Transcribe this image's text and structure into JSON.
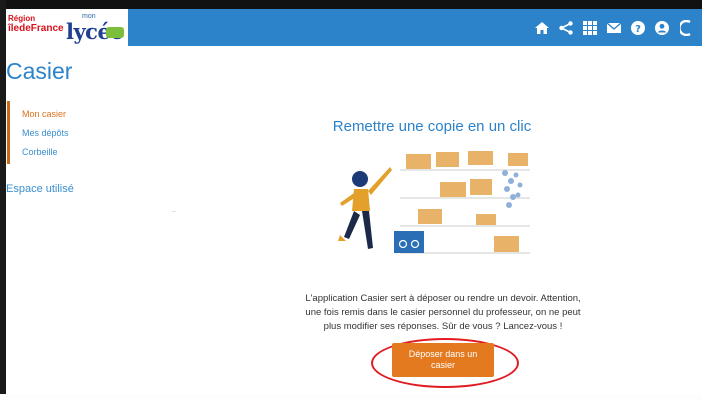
{
  "header": {
    "logo": {
      "region_line1": "Région",
      "region_line2": "îledeFrance",
      "mon": "mon",
      "lycee": "lycée"
    },
    "icons": [
      "home-icon",
      "share-icon",
      "apps-grid-icon",
      "mail-icon",
      "help-icon",
      "user-icon",
      "logout-icon"
    ],
    "bar_color": "#2c83c9"
  },
  "page": {
    "title": "Casier"
  },
  "sidebar": {
    "items": [
      {
        "label": "Mon casier",
        "active": true
      },
      {
        "label": "Mes dépôts",
        "active": false
      },
      {
        "label": "Corbeille",
        "active": false
      }
    ],
    "section": "Espace utilisé",
    "accent_color": "#c96a1b"
  },
  "main": {
    "title": "Remettre une copie en un clic",
    "description": "L'application Casier sert à déposer ou rendre un devoir. Attention, une fois remis dans le casier personnel du professeur, on ne peut plus modifier ses réponses. Sûr de vous ? Lancez-vous !",
    "deposit_button": "Déposer dans un casier",
    "button_color": "#e37a20",
    "highlight_color": "#e11b22"
  }
}
